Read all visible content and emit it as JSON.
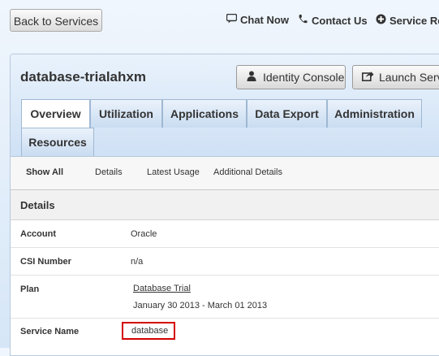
{
  "topbar": {
    "back_label": "Back to Services",
    "chat_label": "Chat Now",
    "contact_label": "Contact Us",
    "service_label": "Service Requ"
  },
  "service": {
    "name": "database-trialahxm",
    "identity_button": "Identity Console",
    "launch_button": "Launch Servi"
  },
  "tabs": [
    {
      "label": "Overview",
      "active": true
    },
    {
      "label": "Utilization"
    },
    {
      "label": "Applications"
    },
    {
      "label": "Data Export"
    },
    {
      "label": "Administration"
    },
    {
      "label": "Resources"
    }
  ],
  "subnav": [
    "Show All",
    "Details",
    "Latest Usage",
    "Additional Details"
  ],
  "details": {
    "title": "Details",
    "account_label": "Account",
    "account_value": "Oracle",
    "csi_label": "CSI Number",
    "csi_value": "n/a",
    "plan_label": "Plan",
    "plan_link": "Database Trial",
    "plan_dates": "January 30 2013 - March 01 2013",
    "service_name_label": "Service Name",
    "service_name_value": "database"
  },
  "colors": {
    "highlight_border": "#d40000"
  }
}
